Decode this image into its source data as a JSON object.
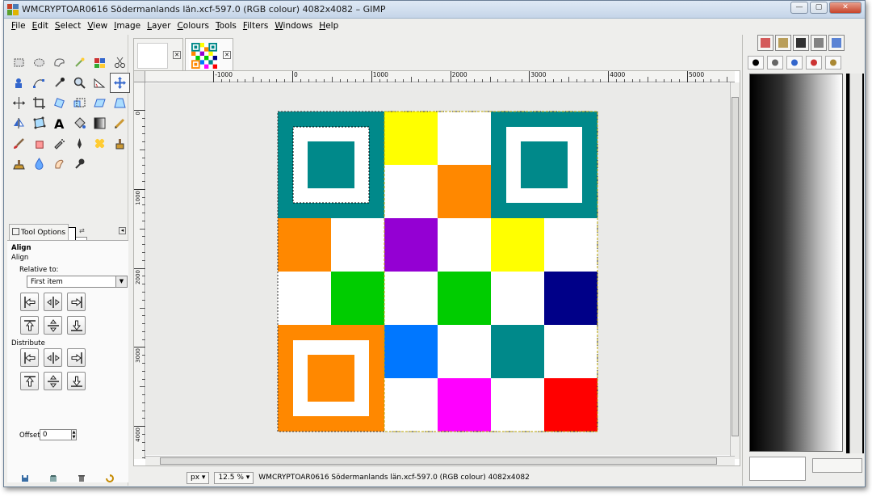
{
  "window": {
    "title": "WMCRYPTOAR0616 Södermanlands län.xcf-597.0 (RGB colour) 4082x4082 – GIMP",
    "buttons": {
      "minimize": "—",
      "maximize": "▢",
      "close": "✕"
    }
  },
  "menubar": {
    "items": [
      {
        "label": "File",
        "key": "F",
        "rest": "ile"
      },
      {
        "label": "Edit",
        "key": "E",
        "rest": "dit"
      },
      {
        "label": "Select",
        "key": "S",
        "rest": "elect"
      },
      {
        "label": "View",
        "key": "V",
        "rest": "iew"
      },
      {
        "label": "Image",
        "key": "I",
        "rest": "mage"
      },
      {
        "label": "Layer",
        "key": "L",
        "rest": "ayer"
      },
      {
        "label": "Colours",
        "key": "C",
        "rest": "olours"
      },
      {
        "label": "Tools",
        "key": "T",
        "rest": "ools"
      },
      {
        "label": "Filters",
        "key": "F",
        "rest": "ilters"
      },
      {
        "label": "Windows",
        "key": "W",
        "rest": "indows"
      },
      {
        "label": "Help",
        "key": "H",
        "rest": "elp"
      }
    ]
  },
  "toolbox": {
    "tools": [
      "rect-select-icon",
      "ellipse-select-icon",
      "free-select-icon",
      "fuzzy-select-icon",
      "by-color-select-icon",
      "scissors-icon",
      "foreground-select-icon",
      "paths-icon",
      "color-picker-icon",
      "zoom-icon",
      "measure-icon",
      "move-icon",
      "align-icon",
      "crop-icon",
      "rotate-icon",
      "scale-icon",
      "shear-icon",
      "perspective-icon",
      "flip-icon",
      "cage-icon",
      "text-icon",
      "bucket-fill-icon",
      "blend-icon",
      "pencil-icon",
      "paintbrush-icon",
      "eraser-icon",
      "airbrush-icon",
      "ink-icon",
      "heal-icon",
      "clone-icon",
      "perspective-clone-icon",
      "blur-icon",
      "smudge-icon",
      "dodge-burn-icon"
    ],
    "selected_tool_index": 11,
    "tool_options": {
      "tab_label": "Tool Options",
      "section_title": "Align",
      "tool_name": "Align",
      "relative_to_label": "Relative to:",
      "relative_to_value": "First item",
      "distribute_label": "Distribute",
      "offset_label": "Offset:",
      "offset_value": "0"
    }
  },
  "image_tabs": [
    {
      "name": "untitled-image",
      "active": false
    },
    {
      "name": "qr-code-image",
      "active": true
    }
  ],
  "rulers": {
    "top": [
      "-1000",
      "0",
      "1000",
      "2000",
      "3000",
      "4000",
      "5000"
    ],
    "left": [
      "0",
      "1000",
      "2000",
      "3000",
      "4000"
    ]
  },
  "statusbar": {
    "unit": "px",
    "zoom": "12.5 %",
    "info": "WMCRYPTOAR0616 Södermanlands län.xcf-597.0 (RGB colour) 4082x4082"
  },
  "qr": {
    "colors": {
      "teal": "#00898a",
      "yellow": "#ffff00",
      "orange": "#ff8800",
      "purple": "#9400d3",
      "green": "#00cc00",
      "navy": "#000088",
      "azure": "#0077ff",
      "magenta": "#ff00ff",
      "red": "#ff0000",
      "white": "#ffffff"
    },
    "cells": [
      {
        "row": 0,
        "col": 2,
        "color": "yellow"
      },
      {
        "row": 1,
        "col": 3,
        "color": "orange"
      },
      {
        "row": 2,
        "col": 0,
        "color": "orange"
      },
      {
        "row": 2,
        "col": 2,
        "color": "purple"
      },
      {
        "row": 2,
        "col": 4,
        "color": "yellow"
      },
      {
        "row": 3,
        "col": 1,
        "color": "green"
      },
      {
        "row": 3,
        "col": 3,
        "color": "green"
      },
      {
        "row": 3,
        "col": 5,
        "color": "navy"
      },
      {
        "row": 4,
        "col": 2,
        "color": "azure"
      },
      {
        "row": 4,
        "col": 4,
        "color": "teal"
      },
      {
        "row": 5,
        "col": 3,
        "color": "magenta"
      },
      {
        "row": 5,
        "col": 5,
        "color": "red"
      }
    ],
    "finders": [
      {
        "position": "top-left",
        "color": "teal"
      },
      {
        "position": "top-right",
        "color": "teal"
      },
      {
        "position": "bottom-left",
        "color": "orange"
      }
    ]
  },
  "dock": {
    "tab_icons": [
      "patterns-icon",
      "brushes-tab-icon",
      "fonts-icon",
      "gradients-icon",
      "palettes-icon"
    ],
    "tool_icons": [
      "colours-dock-icon",
      "printer-icon",
      "brush-icon",
      "gradient-dock-icon",
      "palette-dock-icon"
    ]
  }
}
